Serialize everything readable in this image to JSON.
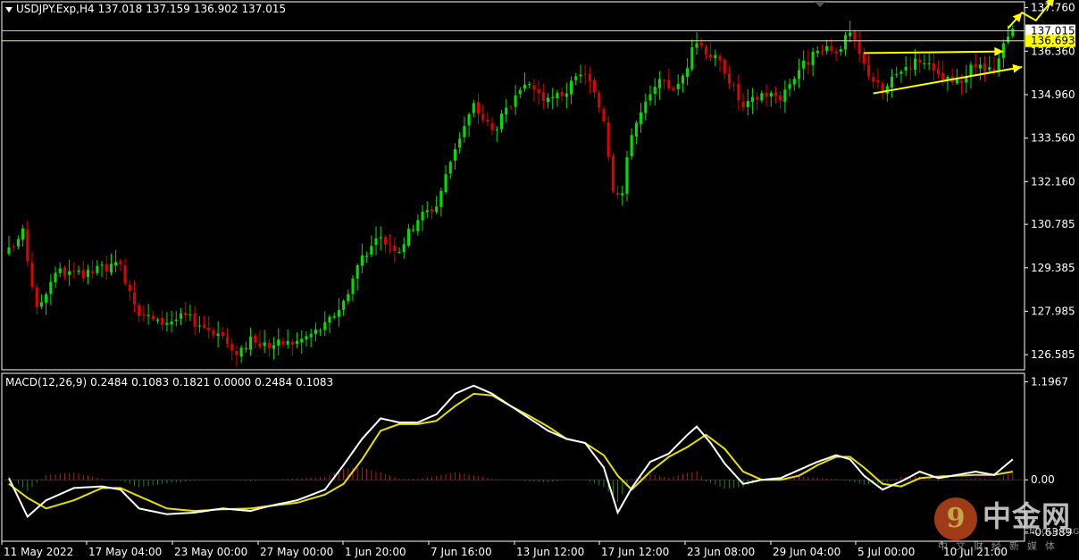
{
  "header": {
    "symbol": "USDJPY.Exp,H4",
    "open": "137.018",
    "high": "137.159",
    "low": "136.902",
    "close": "137.015"
  },
  "macd_header": {
    "label": "MACD(12,26,9)",
    "values": [
      "0.2484",
      "0.1083",
      "0.1821",
      "0.0000",
      "0.2484",
      "0.1083"
    ]
  },
  "watermark": {
    "logo_char": "9",
    "name": "中金网",
    "domain": "CNGOLD.ORG",
    "subtitle": "中文财经新媒体"
  },
  "colors": {
    "background": "#000000",
    "bull": "#00e000",
    "bear": "#e00000",
    "macd_line": "#ffffff",
    "signal_line": "#e8e000",
    "annotation": "#ffff00",
    "price_line": "#c8c8c8",
    "bid_label_bg": "#ffffff",
    "ask_label_bg": "#ffff00"
  },
  "chart_data": [
    {
      "type": "candlestick",
      "y_ticks": [
        "137.760",
        "136.360",
        "134.960",
        "133.560",
        "132.160",
        "130.785",
        "129.385",
        "127.985",
        "126.585"
      ],
      "ylim": [
        126.1,
        137.95
      ],
      "x_ticks": [
        "11 May 2022",
        "17 May 04:00",
        "23 May 00:00",
        "27 May 00:00",
        "1 Jun 20:00",
        "7 Jun 16:00",
        "13 Jun 12:00",
        "17 Jun 12:00",
        "23 Jun 08:00",
        "29 Jun 04:00",
        "5 Jul 00:00",
        "10 Jul 21:00"
      ],
      "price_labels": [
        {
          "value": 137.015,
          "text": "137.015"
        },
        {
          "value": 136.693,
          "text": "136.693"
        }
      ],
      "anchors": [
        [
          0,
          129.9
        ],
        [
          3,
          130.5
        ],
        [
          6,
          128.0
        ],
        [
          10,
          129.3
        ],
        [
          16,
          129.1
        ],
        [
          20,
          129.4
        ],
        [
          24,
          129.4
        ],
        [
          28,
          128.0
        ],
        [
          32,
          127.6
        ],
        [
          38,
          127.8
        ],
        [
          46,
          127.2
        ],
        [
          48,
          126.6
        ],
        [
          52,
          127.0
        ],
        [
          56,
          126.9
        ],
        [
          62,
          127.0
        ],
        [
          68,
          127.5
        ],
        [
          72,
          128.3
        ],
        [
          76,
          129.8
        ],
        [
          80,
          130.3
        ],
        [
          84,
          130.0
        ],
        [
          88,
          131.0
        ],
        [
          92,
          131.4
        ],
        [
          96,
          133.3
        ],
        [
          100,
          134.6
        ],
        [
          104,
          133.8
        ],
        [
          108,
          134.6
        ],
        [
          112,
          135.3
        ],
        [
          116,
          134.7
        ],
        [
          120,
          135.1
        ],
        [
          124,
          135.7
        ],
        [
          128,
          134.2
        ],
        [
          130,
          132.0
        ],
        [
          132,
          131.8
        ],
        [
          134,
          133.8
        ],
        [
          138,
          134.9
        ],
        [
          140,
          135.3
        ],
        [
          144,
          135.2
        ],
        [
          148,
          136.7
        ],
        [
          150,
          136.4
        ],
        [
          154,
          135.8
        ],
        [
          158,
          134.5
        ],
        [
          162,
          135.0
        ],
        [
          166,
          134.9
        ],
        [
          170,
          135.8
        ],
        [
          174,
          136.3
        ],
        [
          178,
          136.4
        ],
        [
          181,
          136.9
        ],
        [
          184,
          135.9
        ],
        [
          188,
          135.0
        ],
        [
          192,
          135.8
        ],
        [
          196,
          136.1
        ],
        [
          200,
          135.5
        ],
        [
          204,
          135.3
        ],
        [
          208,
          135.9
        ],
        [
          212,
          135.6
        ],
        [
          214,
          136.5
        ],
        [
          216,
          137.02
        ]
      ],
      "annotations": [
        {
          "type": "arrow",
          "from": [
            184,
            136.3
          ],
          "to": [
            214,
            136.35
          ]
        },
        {
          "type": "arrow",
          "from": [
            186,
            135.0
          ],
          "to": [
            218,
            135.85
          ]
        },
        {
          "type": "zigzag",
          "points": [
            [
              215,
              137.1
            ],
            [
              218,
              137.6
            ],
            [
              221,
              137.35
            ],
            [
              225,
              138.1
            ]
          ]
        }
      ]
    },
    {
      "type": "macd",
      "params": "MACD(12,26,9)",
      "y_ticks": [
        "1.1967",
        "0.00",
        "-0.6389"
      ],
      "ylim": [
        -0.75,
        1.3
      ],
      "macd_anchors": [
        [
          0,
          0.02
        ],
        [
          4,
          -0.45
        ],
        [
          8,
          -0.25
        ],
        [
          14,
          -0.1
        ],
        [
          20,
          -0.08
        ],
        [
          24,
          -0.12
        ],
        [
          28,
          -0.35
        ],
        [
          34,
          -0.42
        ],
        [
          40,
          -0.4
        ],
        [
          46,
          -0.35
        ],
        [
          52,
          -0.38
        ],
        [
          56,
          -0.32
        ],
        [
          62,
          -0.25
        ],
        [
          68,
          -0.12
        ],
        [
          72,
          0.18
        ],
        [
          76,
          0.5
        ],
        [
          80,
          0.75
        ],
        [
          84,
          0.7
        ],
        [
          88,
          0.7
        ],
        [
          92,
          0.8
        ],
        [
          96,
          1.05
        ],
        [
          100,
          1.15
        ],
        [
          104,
          1.05
        ],
        [
          108,
          0.9
        ],
        [
          112,
          0.75
        ],
        [
          116,
          0.6
        ],
        [
          120,
          0.5
        ],
        [
          124,
          0.45
        ],
        [
          128,
          0.15
        ],
        [
          131,
          -0.4
        ],
        [
          134,
          -0.1
        ],
        [
          138,
          0.22
        ],
        [
          142,
          0.32
        ],
        [
          146,
          0.55
        ],
        [
          148,
          0.65
        ],
        [
          151,
          0.45
        ],
        [
          154,
          0.2
        ],
        [
          158,
          -0.05
        ],
        [
          162,
          0.0
        ],
        [
          166,
          0.02
        ],
        [
          170,
          0.12
        ],
        [
          174,
          0.22
        ],
        [
          178,
          0.3
        ],
        [
          181,
          0.25
        ],
        [
          184,
          0.05
        ],
        [
          188,
          -0.12
        ],
        [
          192,
          -0.02
        ],
        [
          196,
          0.1
        ],
        [
          200,
          0.02
        ],
        [
          204,
          0.06
        ],
        [
          208,
          0.1
        ],
        [
          212,
          0.06
        ],
        [
          216,
          0.25
        ]
      ],
      "signal_anchors": [
        [
          0,
          -0.05
        ],
        [
          4,
          -0.22
        ],
        [
          8,
          -0.35
        ],
        [
          14,
          -0.25
        ],
        [
          20,
          -0.1
        ],
        [
          24,
          -0.1
        ],
        [
          28,
          -0.2
        ],
        [
          34,
          -0.35
        ],
        [
          40,
          -0.38
        ],
        [
          46,
          -0.36
        ],
        [
          52,
          -0.35
        ],
        [
          56,
          -0.32
        ],
        [
          62,
          -0.28
        ],
        [
          68,
          -0.18
        ],
        [
          72,
          -0.05
        ],
        [
          76,
          0.25
        ],
        [
          80,
          0.6
        ],
        [
          84,
          0.68
        ],
        [
          88,
          0.68
        ],
        [
          92,
          0.72
        ],
        [
          96,
          0.9
        ],
        [
          100,
          1.05
        ],
        [
          104,
          1.03
        ],
        [
          108,
          0.9
        ],
        [
          112,
          0.78
        ],
        [
          116,
          0.65
        ],
        [
          120,
          0.5
        ],
        [
          124,
          0.45
        ],
        [
          128,
          0.3
        ],
        [
          131,
          0.05
        ],
        [
          134,
          -0.12
        ],
        [
          138,
          0.1
        ],
        [
          142,
          0.28
        ],
        [
          146,
          0.4
        ],
        [
          150,
          0.55
        ],
        [
          154,
          0.38
        ],
        [
          158,
          0.1
        ],
        [
          162,
          0.0
        ],
        [
          166,
          0.0
        ],
        [
          170,
          0.05
        ],
        [
          174,
          0.18
        ],
        [
          178,
          0.28
        ],
        [
          181,
          0.28
        ],
        [
          184,
          0.15
        ],
        [
          188,
          -0.05
        ],
        [
          192,
          -0.08
        ],
        [
          196,
          0.02
        ],
        [
          200,
          0.04
        ],
        [
          204,
          0.05
        ],
        [
          208,
          0.06
        ],
        [
          212,
          0.06
        ],
        [
          216,
          0.1
        ]
      ]
    }
  ]
}
